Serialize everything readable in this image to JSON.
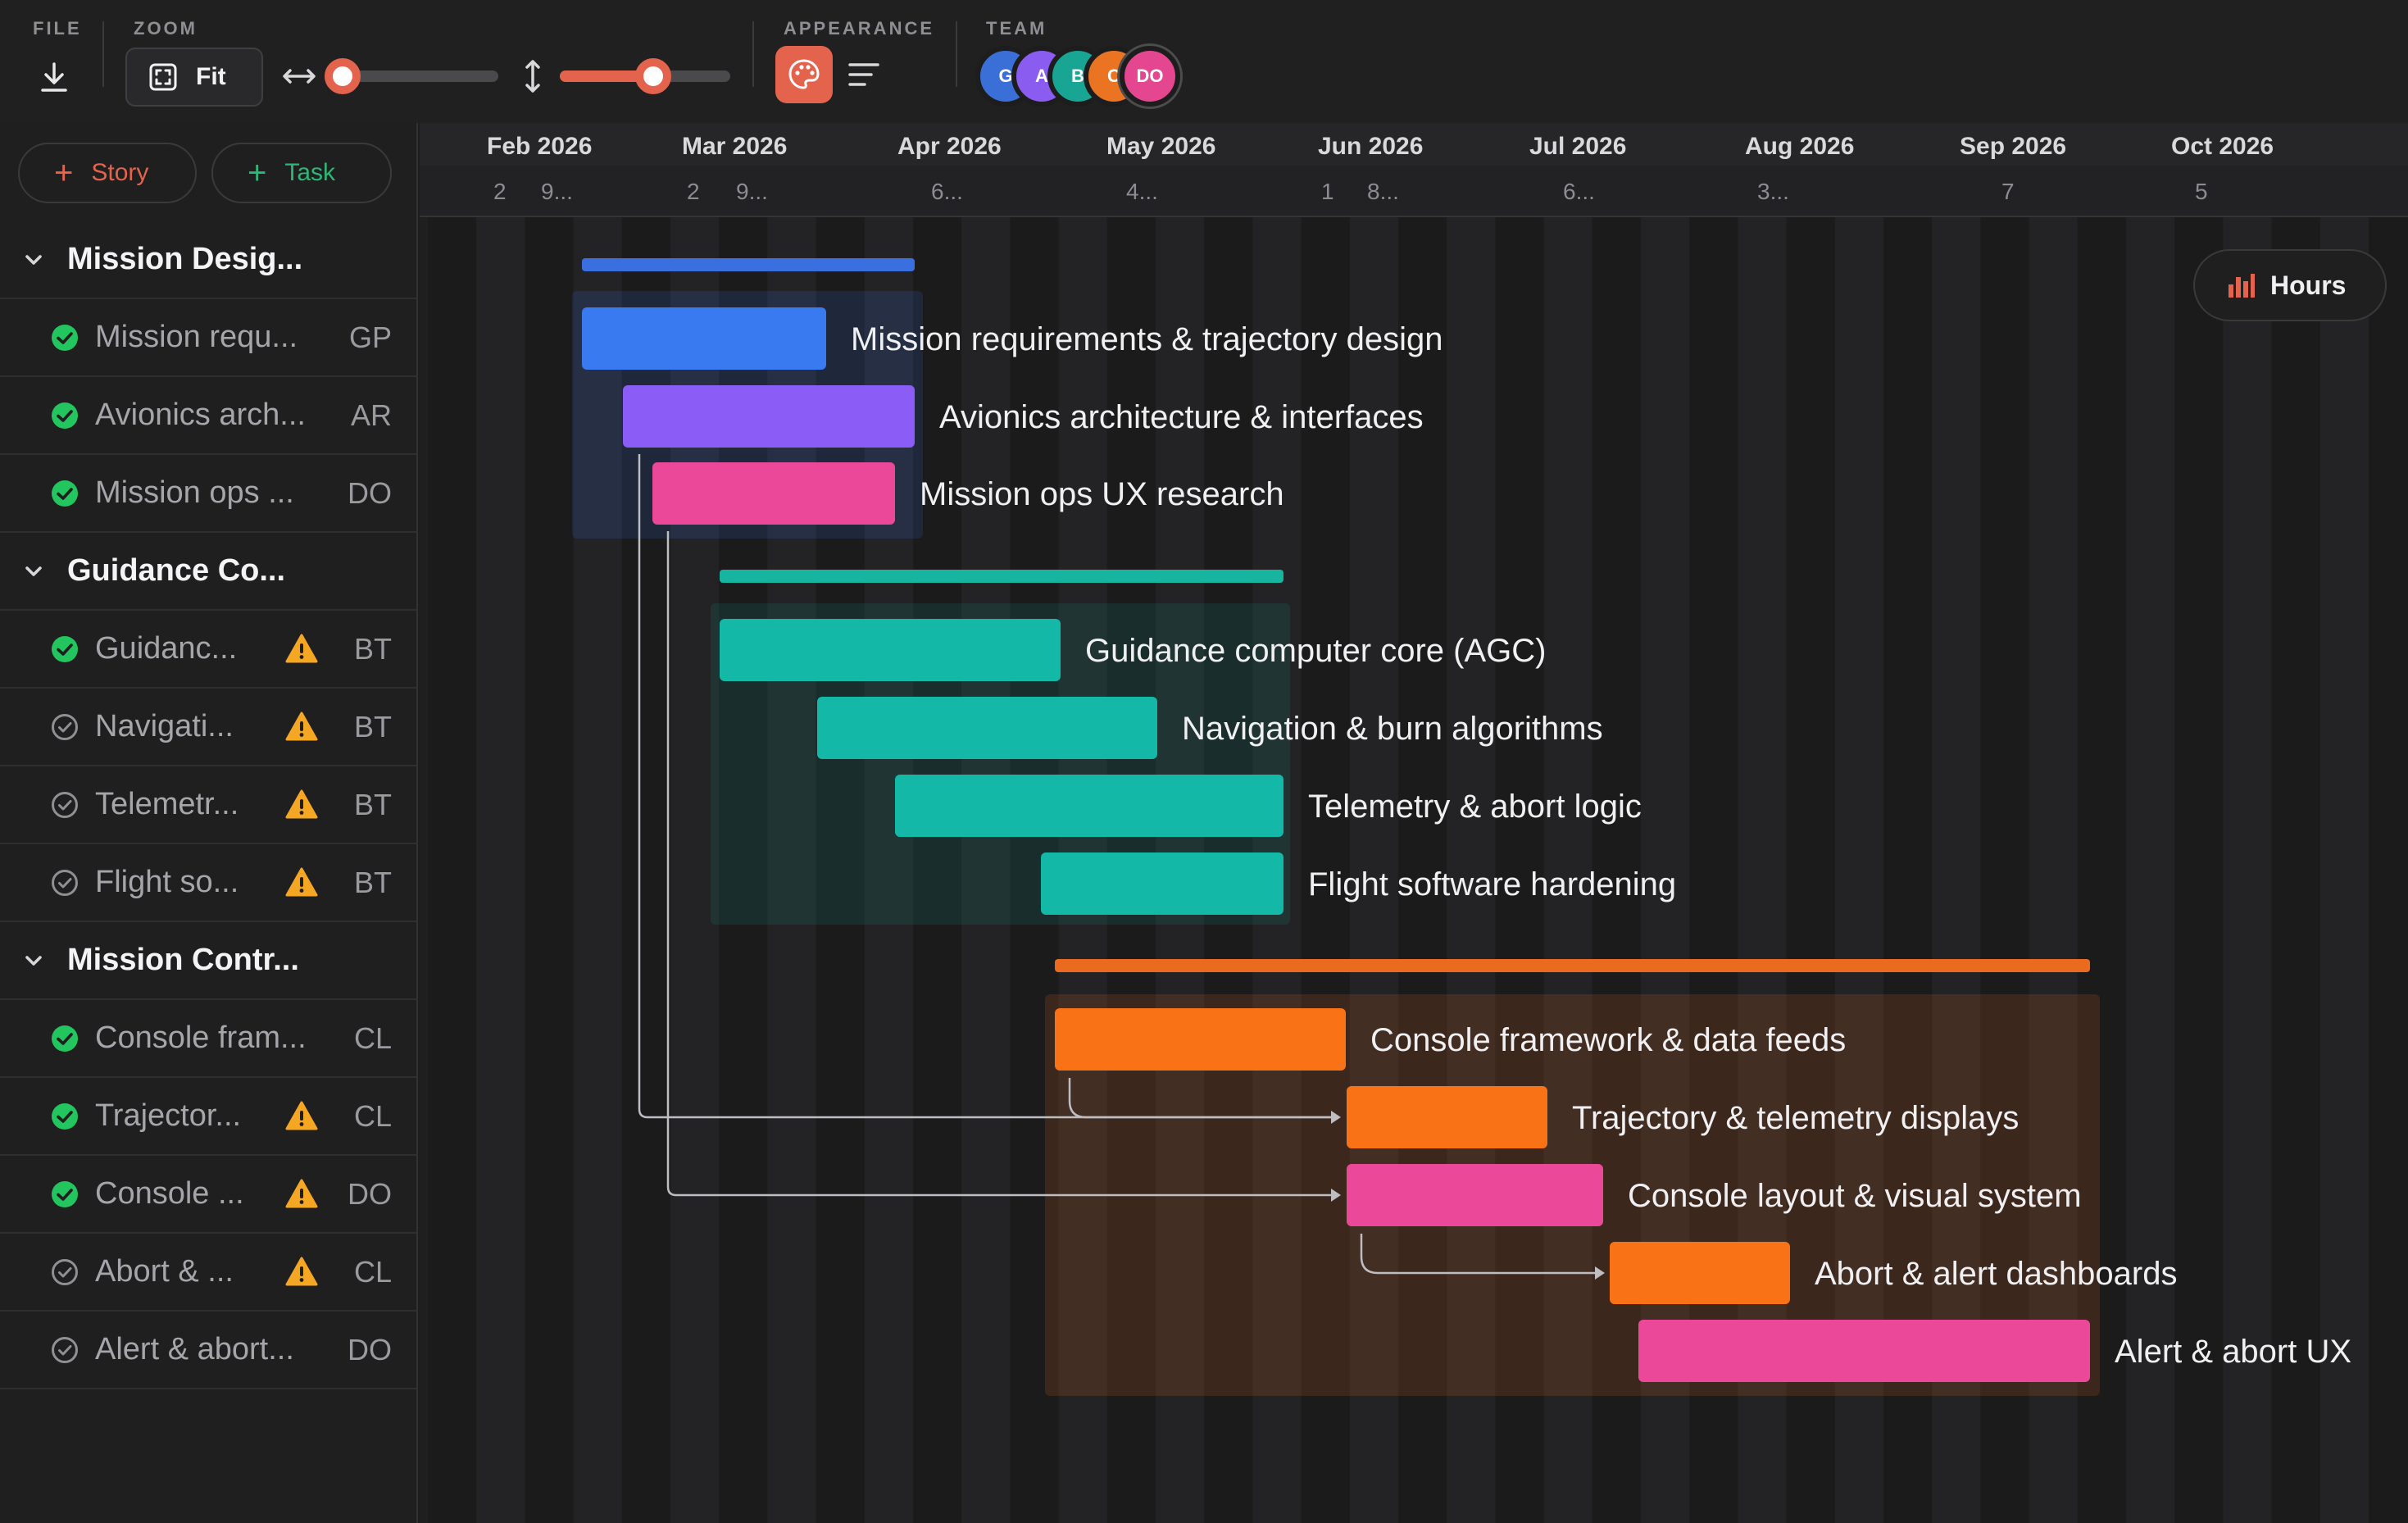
{
  "toolbar": {
    "file_label": "FILE",
    "zoom_label": "ZOOM",
    "fit_label": "Fit",
    "appearance_label": "APPEARANCE",
    "team_label": "TEAM",
    "zoom_horizontal_level": 0.08,
    "zoom_vertical_level": 0.55,
    "accent_color": "#e4634d",
    "team": [
      {
        "initials": "G",
        "color": "#3b6fd8"
      },
      {
        "initials": "A",
        "color": "#8a5cf0"
      },
      {
        "initials": "B",
        "color": "#18a594"
      },
      {
        "initials": "C",
        "color": "#ea7422"
      },
      {
        "initials": "DO",
        "color": "#e4468f"
      }
    ]
  },
  "sidebar": {
    "add_story_label": "Story",
    "add_task_label": "Task",
    "story_color": "#e4634d",
    "task_color": "#2fb577",
    "groups": [
      {
        "name": "Mission Desig...",
        "tasks": [
          {
            "name": "Mission requ...",
            "status": "done",
            "warning": false,
            "assignee": "GP"
          },
          {
            "name": "Avionics arch...",
            "status": "done",
            "warning": false,
            "assignee": "AR"
          },
          {
            "name": "Mission ops ...",
            "status": "done",
            "warning": false,
            "assignee": "DO"
          }
        ]
      },
      {
        "name": "Guidance Co...",
        "tasks": [
          {
            "name": "Guidanc...",
            "status": "done",
            "warning": true,
            "assignee": "BT"
          },
          {
            "name": "Navigati...",
            "status": "pending",
            "warning": true,
            "assignee": "BT"
          },
          {
            "name": "Telemetr...",
            "status": "pending",
            "warning": true,
            "assignee": "BT"
          },
          {
            "name": "Flight so...",
            "status": "pending",
            "warning": true,
            "assignee": "BT"
          }
        ]
      },
      {
        "name": "Mission Contr...",
        "tasks": [
          {
            "name": "Console fram...",
            "status": "done",
            "warning": false,
            "assignee": "CL"
          },
          {
            "name": "Trajector...",
            "status": "done",
            "warning": true,
            "assignee": "CL"
          },
          {
            "name": "Console ...",
            "status": "done",
            "warning": true,
            "assignee": "DO"
          },
          {
            "name": "Abort & ...",
            "status": "pending",
            "warning": true,
            "assignee": "CL"
          },
          {
            "name": "Alert & abort...",
            "status": "pending",
            "warning": false,
            "assignee": "DO"
          }
        ]
      }
    ]
  },
  "timeline": {
    "months": [
      "Feb 2026",
      "Mar 2026",
      "Apr 2026",
      "May 2026",
      "Jun 2026",
      "Jul 2026",
      "Aug 2026",
      "Sep 2026",
      "Oct 2026"
    ],
    "week_ticks": [
      "2",
      "9...",
      "2",
      "9...",
      "6...",
      "4...",
      "1",
      "8...",
      "6...",
      "3...",
      "7",
      "5"
    ],
    "hours_label": "Hours",
    "groups": [
      {
        "color": "#3a6fe0",
        "tasks": [
          {
            "label": "Mission requirements & trajectory design",
            "color": "#3a7af0"
          },
          {
            "label": "Avionics architecture & interfaces",
            "color": "#8b5cf6"
          },
          {
            "label": "Mission ops UX research",
            "color": "#ec4899"
          }
        ]
      },
      {
        "color": "#17b4a0",
        "tasks": [
          {
            "label": "Guidance computer core (AGC)",
            "color": "#14b8a6"
          },
          {
            "label": "Navigation & burn algorithms",
            "color": "#14b8a6"
          },
          {
            "label": "Telemetry & abort logic",
            "color": "#14b8a6"
          },
          {
            "label": "Flight software hardening",
            "color": "#14b8a6"
          }
        ]
      },
      {
        "color": "#ea6a1f",
        "tasks": [
          {
            "label": "Console framework & data feeds",
            "color": "#f97316"
          },
          {
            "label": "Trajectory & telemetry displays",
            "color": "#f97316"
          },
          {
            "label": "Console layout & visual system",
            "color": "#ec4899"
          },
          {
            "label": "Abort & alert dashboards",
            "color": "#f97316"
          },
          {
            "label": "Alert & abort UX",
            "color": "#ec4899"
          }
        ]
      }
    ]
  }
}
